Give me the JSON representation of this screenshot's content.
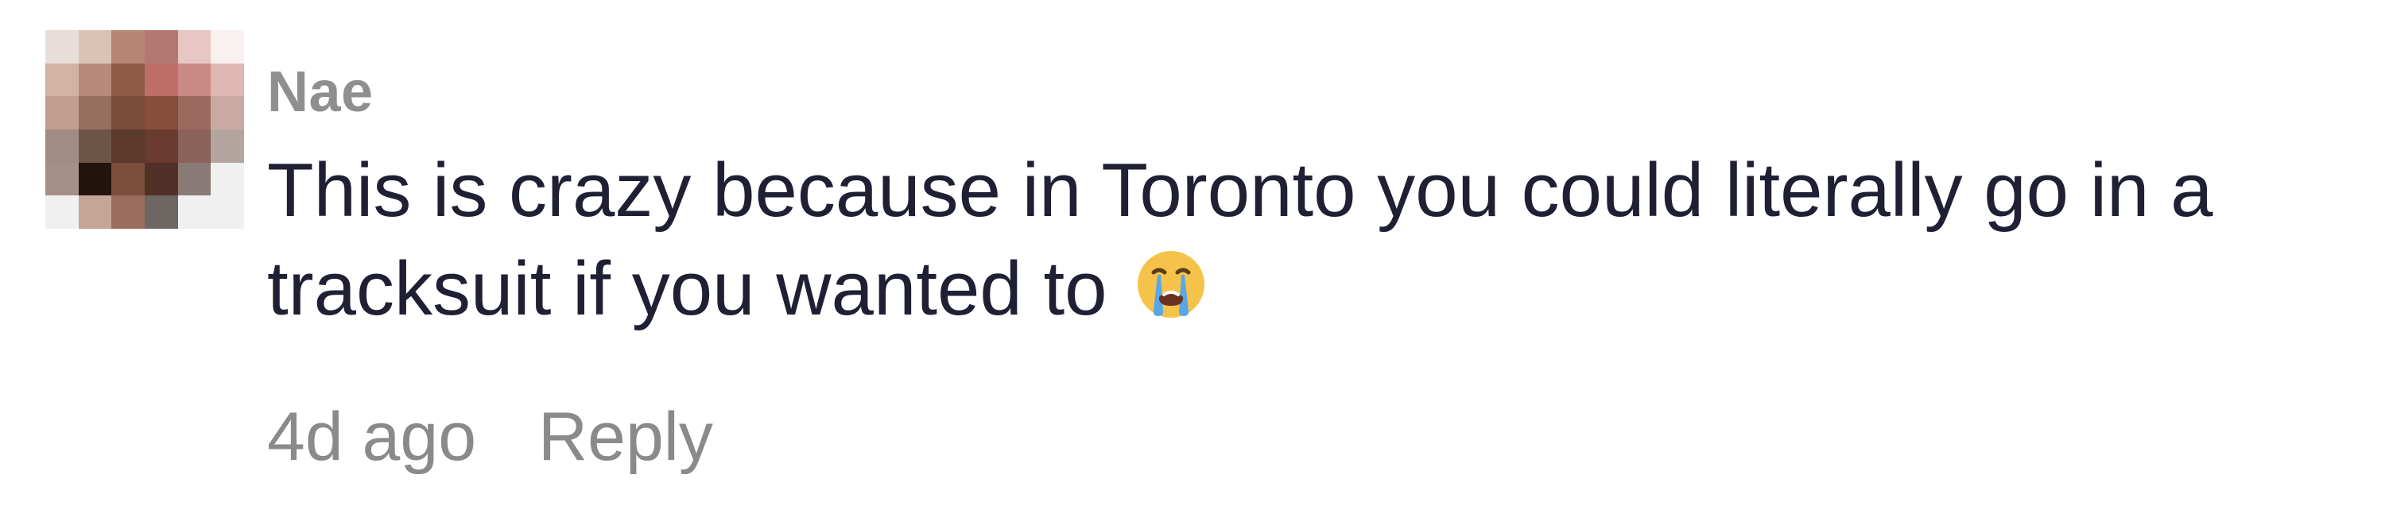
{
  "comment": {
    "username": "Nae",
    "text": "This is crazy because in Toronto you could literally go in a tracksuit if you wanted to",
    "emoji": "😭",
    "timestamp": "4d ago",
    "reply_label": "Reply"
  },
  "avatar": {
    "semantic": "pixelated-profile-avatar",
    "colors": [
      "#e8ded9",
      "#dac2b5",
      "#b68573",
      "#b37872",
      "#e8c6c4",
      "#f8f1ef",
      "#d3b3a4",
      "#b8897a",
      "#8f5a47",
      "#bf6d67",
      "#c98a86",
      "#dfb6b1",
      "#c19d90",
      "#96705e",
      "#7b4b3a",
      "#874d3d",
      "#9d6a5f",
      "#c8aaa3",
      "#a18b83",
      "#6d5447",
      "#5b3a2b",
      "#6a3b2e",
      "#8a625a",
      "#b4a5a1",
      "#a58f87",
      "#22150f",
      "#7b4e3c",
      "#513027",
      "#8b7b78",
      "#f0f0f0",
      "#f0f0f0",
      "#c5a596",
      "#9a6d5f",
      "#6d6663",
      "#f0f0f0",
      "#f0f0f0"
    ]
  }
}
